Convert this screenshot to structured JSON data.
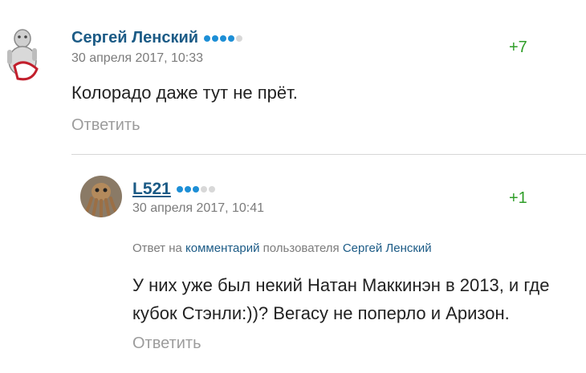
{
  "comments": [
    {
      "author": "Сергей Ленский",
      "date": "30 апреля 2017, 10:33",
      "score": "+7",
      "text": "Колорадо даже тут не прёт.",
      "reply_label": "Ответить",
      "rank_dots": {
        "filled": 4,
        "total": 5
      },
      "avatar_icon": "sheep-mascot-icon"
    },
    {
      "author": "L521",
      "date": "30 апреля 2017, 10:41",
      "score": "+1",
      "reply_to": {
        "prefix": "Ответ на",
        "comment_link": "комментарий",
        "middle": "пользователя",
        "user_link": "Сергей Ленский"
      },
      "text": "У них уже был некий Натан Маккинэн в 2013, и где кубок Стэнли:))? Вегасу не поперло и Аризон.",
      "reply_label": "Ответить",
      "rank_dots": {
        "filled": 3,
        "total": 5
      },
      "avatar_icon": "octopus-photo-icon"
    }
  ],
  "colors": {
    "author": "#1c5b86",
    "score": "#2f9e28",
    "rank_on": "#1e8fd6",
    "rank_off": "#d8d8d8",
    "muted": "#7b7b7b"
  }
}
